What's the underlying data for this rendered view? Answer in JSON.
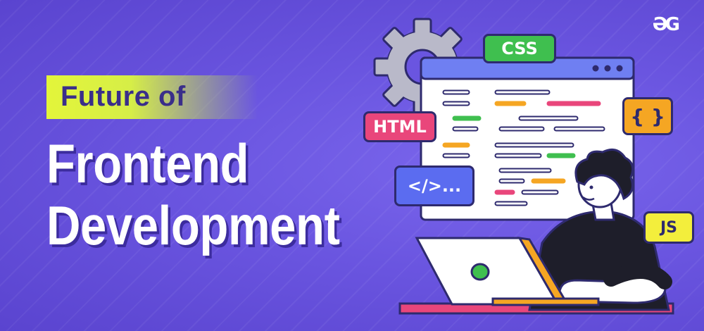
{
  "brand": {
    "logo_text": "ƏG"
  },
  "headline": {
    "subtitle": "Future of",
    "line1": "Frontend",
    "line2": "Development"
  },
  "badges": {
    "css": "CSS",
    "html": "HTML",
    "braces": "{ }",
    "tag": "</>...",
    "js": "JS"
  },
  "colors": {
    "background": "#6a55e0",
    "subtitle_highlight": "#e3f53a",
    "css_badge": "#3fbf4f",
    "html_badge": "#e9467b",
    "braces_badge": "#f5a623",
    "tag_badge": "#5b6cf0",
    "js_badge": "#f3ee3c"
  }
}
